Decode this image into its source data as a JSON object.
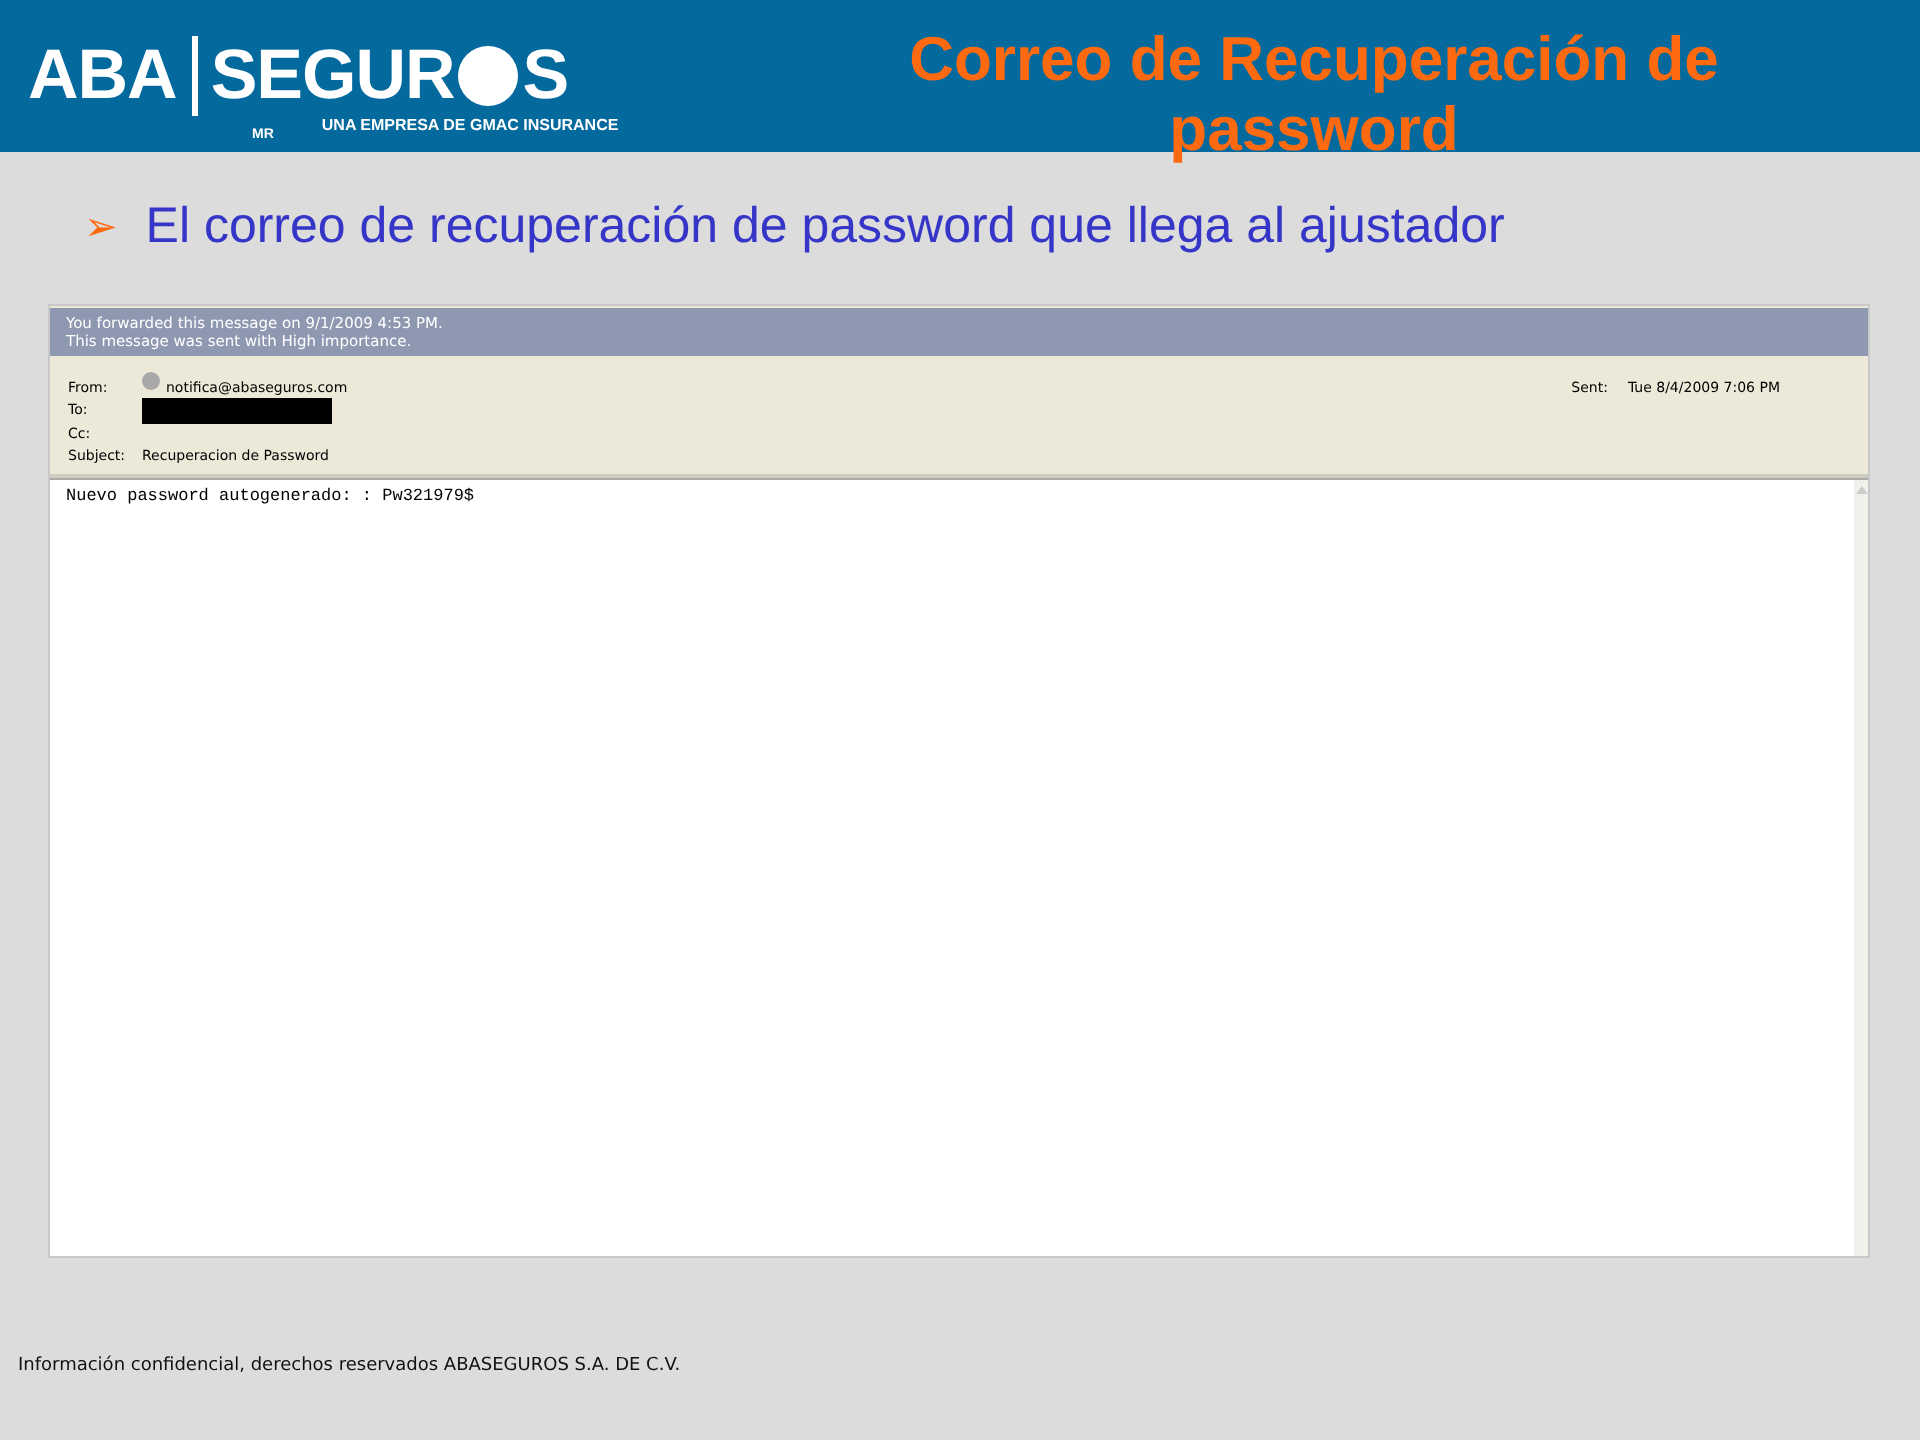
{
  "header": {
    "logo": {
      "left": "ABA",
      "brand": "SEGUR",
      "brand_end": "S",
      "mark": "MR",
      "tagline": "UNA EMPRESA DE GMAC INSURANCE"
    },
    "title": "Correo de Recuperación de password"
  },
  "bullet": {
    "marker": "➢",
    "text": "El correo de recuperación de password que llega al ajustador"
  },
  "email": {
    "info_lines": [
      "You forwarded this message on 9/1/2009 4:53 PM.",
      "This message was sent with High importance."
    ],
    "fields": [
      {
        "kind": "sender",
        "label": "From:",
        "value": "notifica@abaseguros.com"
      },
      {
        "kind": "redacted",
        "label": "To:"
      },
      {
        "kind": "empty",
        "label": "Cc:"
      },
      {
        "kind": "text",
        "label": "Subject:",
        "value": "Recuperacion de Password"
      }
    ],
    "sent": {
      "label": "Sent:",
      "value": "Tue 8/4/2009 7:06 PM"
    },
    "body": "Nuevo password autogenerado: : Pw321979$"
  },
  "footer": "Información confidencial, derechos reservados ABASEGUROS S.A. DE C.V."
}
